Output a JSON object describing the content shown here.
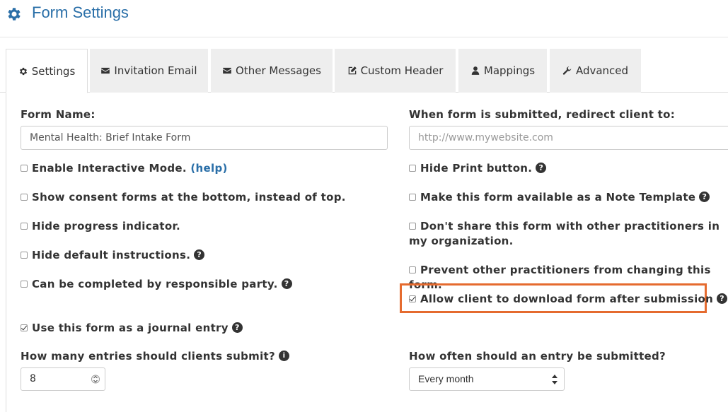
{
  "header": {
    "title": "Form Settings",
    "icon": "gear-icon"
  },
  "tabs": [
    {
      "label": "Settings",
      "icon": "gear-icon",
      "active": true
    },
    {
      "label": "Invitation Email",
      "icon": "envelope-icon",
      "active": false
    },
    {
      "label": "Other Messages",
      "icon": "envelope-icon",
      "active": false
    },
    {
      "label": "Custom Header",
      "icon": "edit-icon",
      "active": false
    },
    {
      "label": "Mappings",
      "icon": "user-icon",
      "active": false
    },
    {
      "label": "Advanced",
      "icon": "wrench-icon",
      "active": false
    }
  ],
  "form_name": {
    "label": "Form Name:",
    "value": "Mental Health: Brief Intake Form"
  },
  "redirect": {
    "label": "When form is submitted, redirect client to:",
    "placeholder": "http://www.mywebsite.com"
  },
  "left_options": [
    {
      "label": "Enable Interactive Mode.",
      "checked": false,
      "link": "(help)"
    },
    {
      "label": "Show consent forms at the bottom, instead of top.",
      "checked": false
    },
    {
      "label": "Hide progress indicator.",
      "checked": false
    },
    {
      "label": "Hide default instructions.",
      "checked": false,
      "help": true
    },
    {
      "label": "Can be completed by responsible party.",
      "checked": false,
      "help": true
    },
    {
      "label": "Use this form as a journal entry",
      "checked": true,
      "help": true
    }
  ],
  "right_options": [
    {
      "label": "Hide Print button.",
      "checked": false,
      "help": true
    },
    {
      "label": "Make this form available as a Note Template",
      "checked": false,
      "help": true
    },
    {
      "label": "Don't share this form with other practitioners in my organization.",
      "checked": false
    },
    {
      "label": "Prevent other practitioners from changing this form.",
      "checked": false
    },
    {
      "label": "Allow client to download form after submission",
      "checked": true,
      "help": true,
      "highlighted": true
    }
  ],
  "entries": {
    "label": "How many entries should clients submit?",
    "value": "8"
  },
  "frequency": {
    "label": "How often should an entry be submitted?",
    "selected": "Every month"
  },
  "colors": {
    "accent": "#2a6fa8",
    "highlight": "#e56b2f",
    "tab_bg": "#eeeeee"
  }
}
